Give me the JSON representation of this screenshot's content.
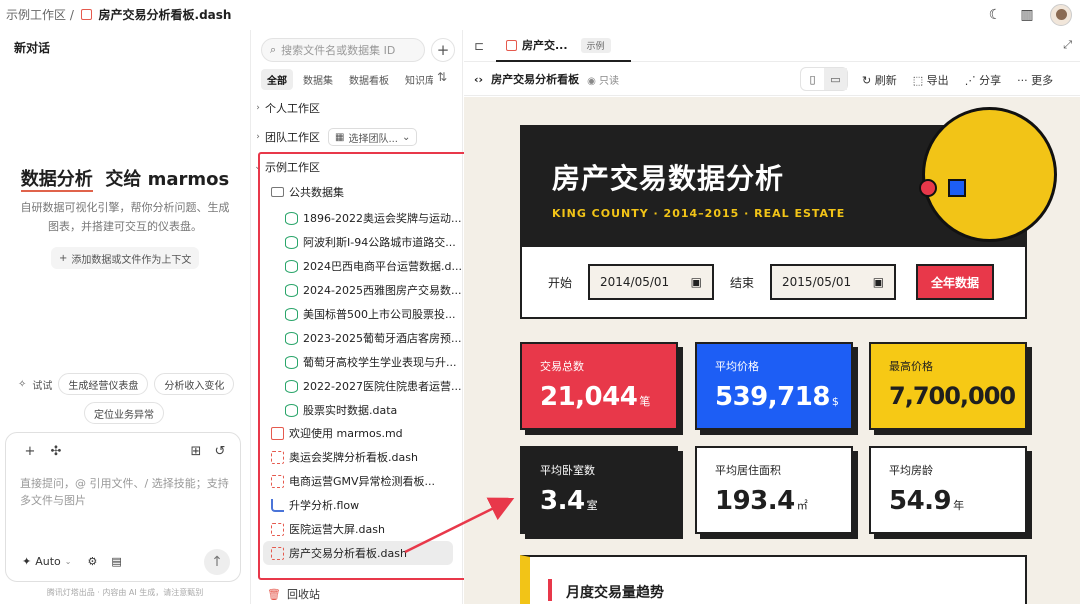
{
  "topbar": {
    "breadcrumb_root": "示例工作区 /",
    "breadcrumb_file": "房产交易分析看板.dash"
  },
  "chat": {
    "new_chat": "新对话",
    "hero_part1": "数据分析",
    "hero_part2": "交给 marmos",
    "subtitle": "自研数据可视化引擎，帮你分析问题、生成图表，并搭建可交互的仪表盘。",
    "add_context": "添加数据或文件作为上下文",
    "try_label": "试试",
    "chips": [
      "生成经营仪表盘",
      "分析收入变化",
      "定位业务异常"
    ],
    "input_placeholder": "直接提问，@ 引用文件、/ 选择技能；支持多文件与图片",
    "mode": "Auto",
    "footnote": "腾讯灯塔出品 · 内容由 AI 生成，请注意甄别"
  },
  "tree": {
    "search_placeholder": "搜索文件名或数据集 ID",
    "tabs": [
      "全部",
      "数据集",
      "数据看板",
      "知识库"
    ],
    "personal": "个人工作区",
    "team": "团队工作区",
    "team_select": "选择团队...",
    "example": "示例工作区",
    "public_folder": "公共数据集",
    "datasets": [
      "1896-2022奥运会奖牌与运动...",
      "阿波利斯I-94公路城市道路交...",
      "2024巴西电商平台运营数据.d...",
      "2024-2025西雅图房产交易数...",
      "美国标普500上市公司股票投...",
      "2023-2025葡萄牙酒店客房预...",
      "葡萄牙高校学生学业表现与升...",
      "2022-2027医院住院患者运营...",
      "股票实时数据.data"
    ],
    "files": [
      {
        "name": "欢迎使用 marmos.md",
        "kind": "md"
      },
      {
        "name": "奥运会奖牌分析看板.dash",
        "kind": "dash"
      },
      {
        "name": "电商运营GMV异常检测看板...",
        "kind": "dash"
      },
      {
        "name": "升学分析.flow",
        "kind": "flow"
      },
      {
        "name": "医院运营大屏.dash",
        "kind": "dash"
      },
      {
        "name": "房产交易分析看板.dash",
        "kind": "dash"
      }
    ],
    "trash": "回收站"
  },
  "preview": {
    "tab_label": "房产交...",
    "tab_badge": "示例",
    "title": "房产交易分析看板",
    "readonly": "只读",
    "actions": [
      "刷新",
      "导出",
      "分享",
      "更多"
    ]
  },
  "dashboard": {
    "title": "房产交易数据分析",
    "subtitle": "KING COUNTY · 2014–2015 · REAL ESTATE",
    "start_label": "开始",
    "start_date": "2014/05/01",
    "end_label": "结束",
    "end_date": "2015/05/01",
    "all_button": "全年数据",
    "kpis": [
      {
        "label": "交易总数",
        "value": "21,044",
        "unit": "笔",
        "bg": "#e8384a",
        "fg": "#ffffff"
      },
      {
        "label": "平均价格",
        "value": "539,718",
        "unit": "$",
        "bg": "#1d5ef5",
        "fg": "#ffffff"
      },
      {
        "label": "最高价格",
        "value": "7,700,000",
        "unit": "",
        "bg": "#f6c915",
        "fg": "#1f1f1f"
      },
      {
        "label": "平均卧室数",
        "value": "3.4",
        "unit": "室",
        "bg": "#1f1f1f",
        "fg": "#ffffff"
      },
      {
        "label": "平均居住面积",
        "value": "193.4",
        "unit": "㎡",
        "bg": "#ffffff",
        "fg": "#1f1f1f"
      },
      {
        "label": "平均房龄",
        "value": "54.9",
        "unit": "年",
        "bg": "#ffffff",
        "fg": "#1f1f1f"
      }
    ],
    "trend_title": "月度交易量趋势"
  }
}
